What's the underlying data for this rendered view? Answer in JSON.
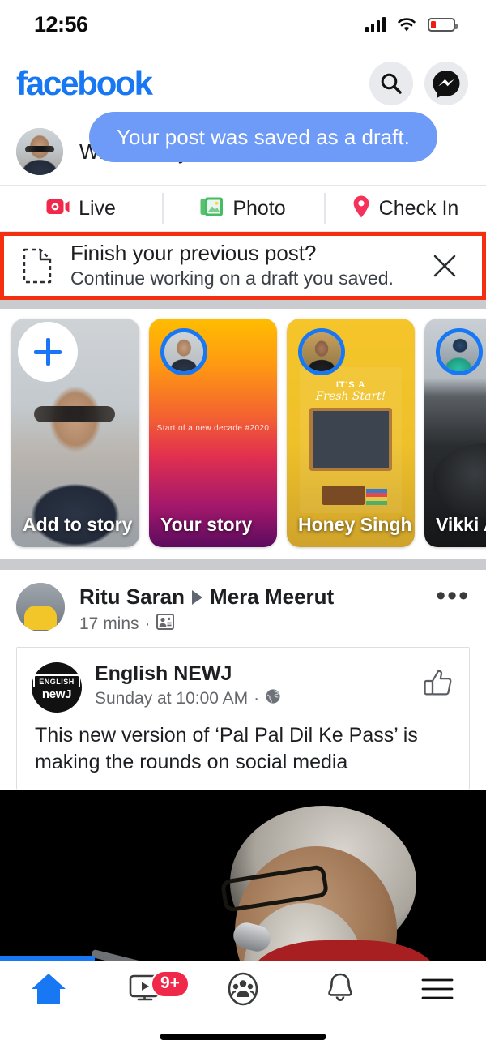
{
  "status_bar": {
    "time": "12:56",
    "signal_icon": "cellular-signal-icon",
    "wifi_icon": "wifi-icon",
    "battery_icon": "battery-low-icon",
    "battery_level_pct": 20
  },
  "header": {
    "logo_text": "facebook",
    "logo_color": "#1877f2",
    "search_icon": "search-icon",
    "messenger_icon": "messenger-icon"
  },
  "toast": {
    "message": "Your post was saved as a draft.",
    "background_color": "#6e9bf7",
    "text_color": "#ffffff"
  },
  "composer": {
    "placeholder": "What's on your mind?",
    "avatar_icon": "user-avatar"
  },
  "composer_actions": [
    {
      "label": "Live",
      "icon": "live-video-icon",
      "color": "#f02849"
    },
    {
      "label": "Photo",
      "icon": "photo-icon",
      "color": "#45bd62"
    },
    {
      "label": "Check In",
      "icon": "location-pin-icon",
      "color": "#f5325b"
    }
  ],
  "draft_banner": {
    "icon": "draft-document-icon",
    "title": "Finish your previous post?",
    "subtitle": "Continue working on a draft you saved.",
    "close_icon": "close-icon",
    "highlight_border_color": "#f42f10"
  },
  "stories": [
    {
      "label": "Add to story",
      "type": "add",
      "plus_icon": "plus-icon",
      "caption": ""
    },
    {
      "label": "Your story",
      "type": "gradient",
      "caption": "Start of a new decade #2020"
    },
    {
      "label": "Honey Singh",
      "type": "card",
      "caption": "",
      "card_line1": "IT'S A",
      "card_line2": "Fresh Start!"
    },
    {
      "label": "Vikki An",
      "type": "photo",
      "caption": ""
    }
  ],
  "post": {
    "author": "Ritu Saran",
    "group": "Mera Meerut",
    "share_arrow_icon": "share-triangle-icon",
    "timestamp": "17 mins",
    "audience_icon": "group-audience-icon",
    "more_icon": "more-options-icon",
    "shared": {
      "page_name": "English NEWJ",
      "logo_top": "ENGLISH",
      "logo_bottom": "newJ",
      "timestamp": "Sunday at 10:00 AM",
      "privacy_icon": "globe-icon",
      "like_icon": "thumbs-up-icon",
      "body": "This new version of ‘Pal Pal Dil Ke Pass’ is making the rounds on social media"
    },
    "media_icon": "video-thumbnail"
  },
  "bottom_nav": {
    "items": [
      {
        "name": "home",
        "icon": "home-icon",
        "active": true,
        "badge": ""
      },
      {
        "name": "watch",
        "icon": "watch-video-icon",
        "active": false,
        "badge": "9+"
      },
      {
        "name": "groups",
        "icon": "groups-icon",
        "active": false,
        "badge": ""
      },
      {
        "name": "notifications",
        "icon": "bell-icon",
        "active": false,
        "badge": ""
      },
      {
        "name": "menu",
        "icon": "hamburger-menu-icon",
        "active": false,
        "badge": ""
      }
    ],
    "active_color": "#1877f2",
    "badge_color": "#f02849",
    "loading_bar_color": "#1877f2"
  }
}
